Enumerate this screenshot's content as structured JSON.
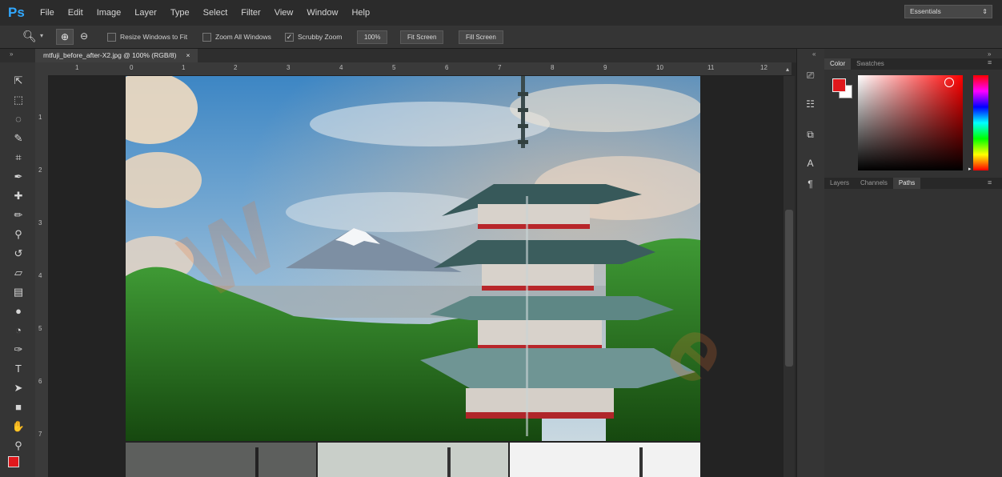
{
  "app": {
    "logo": "Ps"
  },
  "menu": [
    "File",
    "Edit",
    "Image",
    "Layer",
    "Type",
    "Select",
    "Filter",
    "View",
    "Window",
    "Help"
  ],
  "window_controls": {
    "minimize": "–",
    "restore": "⧉",
    "close": "✕"
  },
  "options_bar": {
    "resize_windows_label": "Resize Windows to Fit",
    "zoom_all_label": "Zoom All Windows",
    "scrubby_zoom_label": "Scrubby Zoom",
    "scrubby_zoom_checked": "✓",
    "zoom_100": "100%",
    "fit_screen": "Fit Screen",
    "fill_screen": "Fill Screen",
    "workspace": "Essentials"
  },
  "document_tab": {
    "title": "mtfuji_before_after-X2.jpg @ 100% (RGB/8)",
    "close": "×"
  },
  "ruler": {
    "top_ticks": [
      "1",
      "0",
      "1",
      "2",
      "3",
      "4",
      "5",
      "6",
      "7",
      "8",
      "9",
      "10",
      "11",
      "12"
    ],
    "left_ticks": [
      "1",
      "2",
      "3",
      "4",
      "5",
      "6",
      "7"
    ]
  },
  "panels": {
    "color_tabs": [
      "Color",
      "Swatches"
    ],
    "layer_tabs": [
      "Layers",
      "Channels",
      "Paths"
    ],
    "foreground_color": "#e0181c",
    "background_color": "#ffffff"
  },
  "dock_icons": [
    "history-icon",
    "properties-icon",
    "adjustments-icon",
    "character-icon",
    "paragraph-icon"
  ],
  "tools": [
    "move-icon",
    "marquee-icon",
    "lasso-icon",
    "quick-select-icon",
    "crop-icon",
    "eyedropper-icon",
    "healing-brush-icon",
    "brush-icon",
    "clone-stamp-icon",
    "history-brush-icon",
    "eraser-icon",
    "gradient-icon",
    "blur-icon",
    "dodge-icon",
    "pen-icon",
    "type-icon",
    "path-select-icon",
    "shape-icon",
    "hand-icon",
    "zoom-icon"
  ]
}
